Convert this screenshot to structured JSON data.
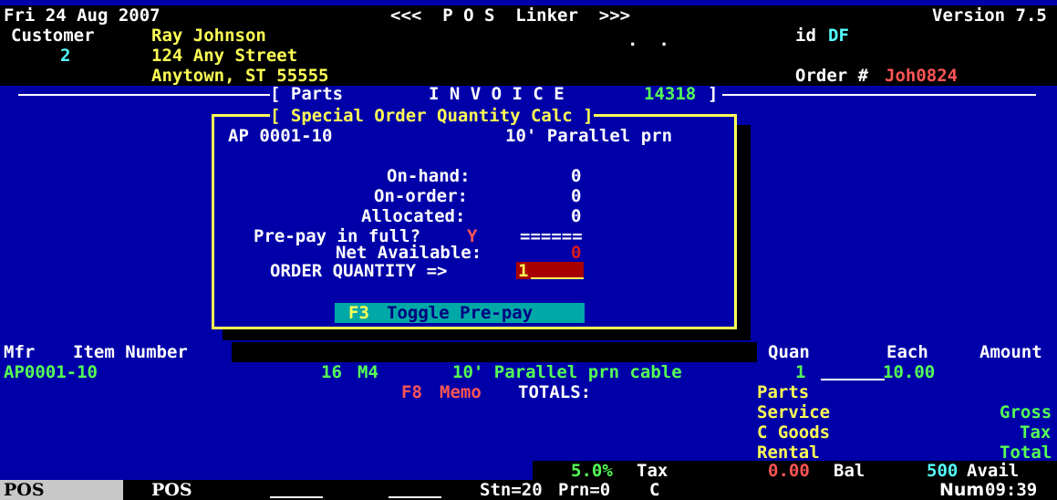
{
  "header": {
    "date": "Fri 24 Aug 2007",
    "title": "<<<  P O S  Linker  >>>",
    "version": "Version 7.5"
  },
  "customer": {
    "label": "Customer",
    "number": "2",
    "name": "Ray Johnson",
    "street": "124 Any Street",
    "city": "Anytown, ST 55555",
    "dots": ".  .",
    "id_label": "id",
    "id_value": "DF",
    "order_label": "Order #",
    "order_value": "Joh0824"
  },
  "invoice_bar": {
    "left": "[ Parts",
    "title": "I N V O I C E",
    "number": "14318",
    "right": "]"
  },
  "dialog": {
    "title": "[ Special Order Quantity Calc ]",
    "item_code": "AP 0001-10",
    "item_desc": "10' Parallel prn",
    "on_hand_label": "On-hand:",
    "on_hand_value": "0",
    "on_order_label": "On-order:",
    "on_order_value": "0",
    "allocated_label": "Allocated:",
    "allocated_value": "0",
    "prepay_label": "Pre-pay in full?",
    "prepay_value": "Y",
    "prepay_rule": "======",
    "net_available_label": "Net Available:",
    "net_available_value": "0",
    "order_qty_label": "ORDER QUANTITY =>",
    "order_qty_value": "1",
    "toggle_key": "F3",
    "toggle_label": "Toggle Pre-pay"
  },
  "columns": {
    "mfr": "Mfr",
    "item_number": "Item Number",
    "quan": "Quan",
    "each": "Each",
    "amount": "Amount"
  },
  "line_item": {
    "item": "AP0001-10",
    "qty_a": "16",
    "loc": "M4",
    "desc": "10' Parallel prn cable",
    "quan": "1",
    "each": "10.00"
  },
  "memo": {
    "key": "F8",
    "label": "Memo",
    "totals": "TOTALS:"
  },
  "totals": {
    "left": [
      "Parts",
      "Service",
      "C Goods",
      "Rental"
    ],
    "right": [
      "Gross",
      "Tax",
      "Total"
    ]
  },
  "bottom": {
    "tax_rate": "5.0%",
    "tax_label": "Tax",
    "bal_value": "0.00",
    "bal_label": "Bal",
    "avail_value": "500",
    "avail_label": "Avail"
  },
  "statusbar": {
    "tab1": "POS",
    "tab2": "POS",
    "station": "Stn=20",
    "printer": "Prn=0",
    "mode": "C",
    "num": "Num",
    "time": "09:39"
  }
}
